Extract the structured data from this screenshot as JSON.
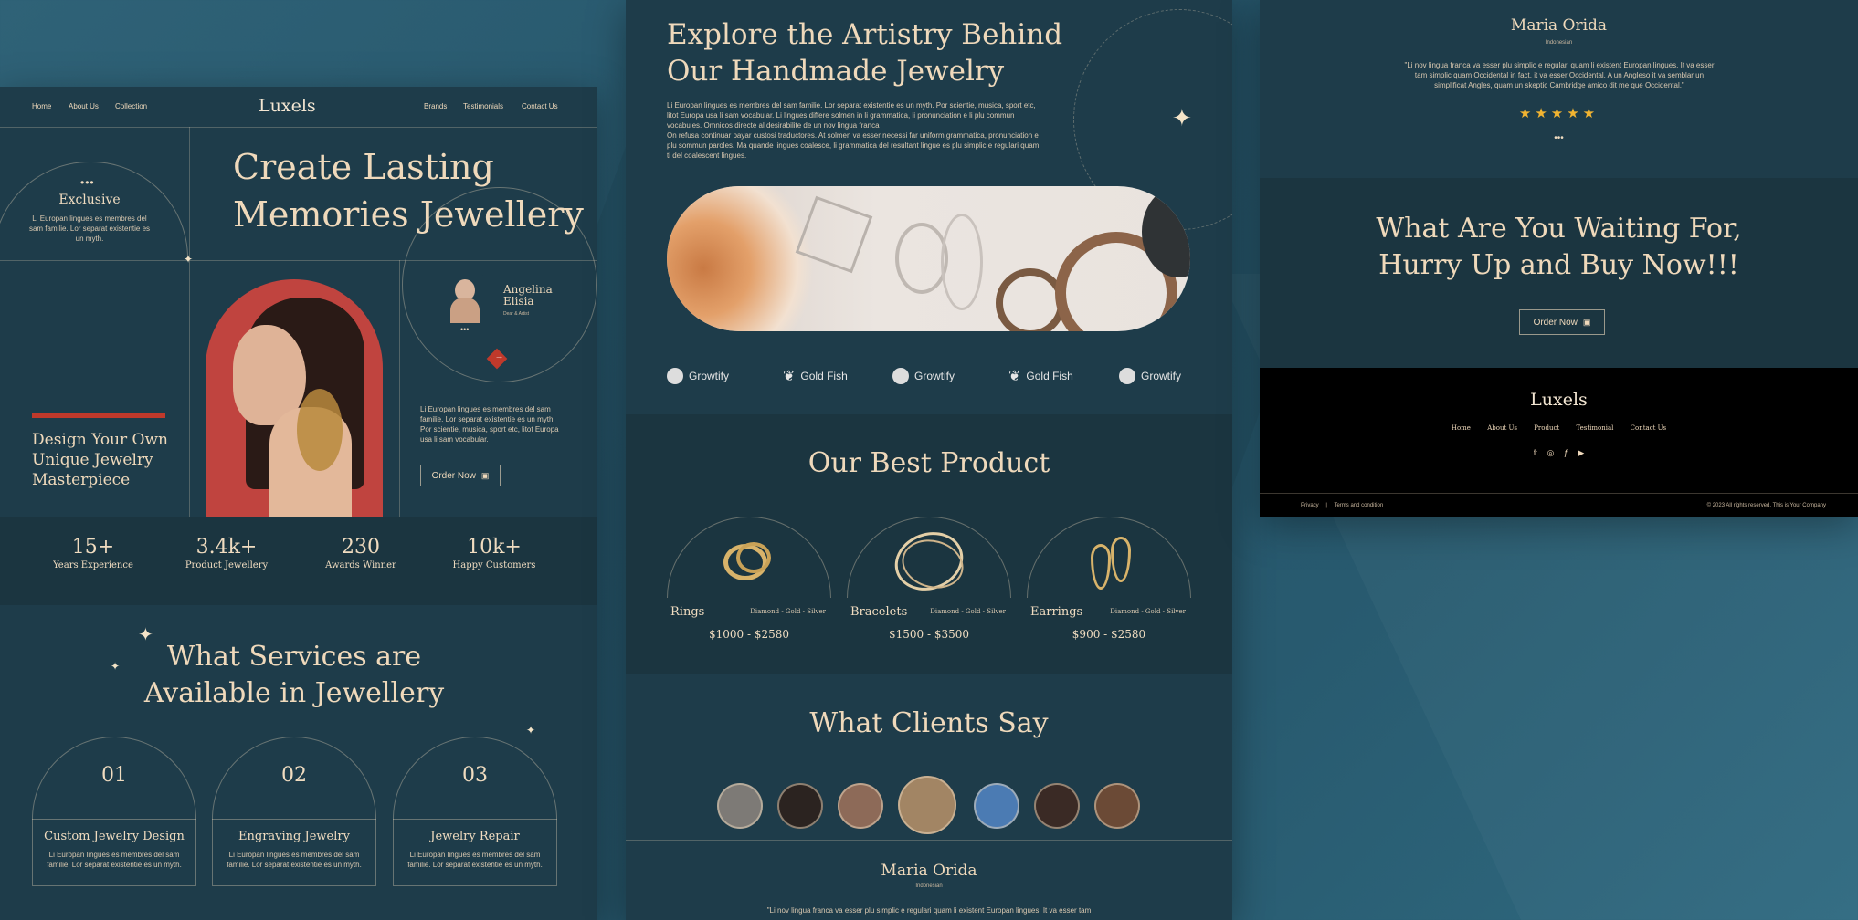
{
  "left": {
    "nav": {
      "home": "Home",
      "about": "About Us",
      "collection": "Collection",
      "brands": "Brands",
      "testimonials": "Testimonials",
      "contact": "Contact Us",
      "logo": "Luxels"
    },
    "exclusive": {
      "title": "Exclusive",
      "text": "Li Europan lingues es membres del sam familie. Lor separat existentie es un myth."
    },
    "hero_title_1": "Create Lasting",
    "hero_title_2": "Memories Jewellery",
    "side_title_1": "Design Your Own",
    "side_title_2": "Unique Jewelry",
    "side_title_3": "Masterpiece",
    "profile": {
      "name_1": "Angelina",
      "name_2": "Elisia",
      "role": "Dear & Artist"
    },
    "body_text": "Li Europan lingues es membres del sam familie. Lor separat existentie es un myth. Por scientie, musica, sport etc, litot Europa usa li sam vocabular.",
    "order_button": "Order Now",
    "stats": [
      {
        "value": "15+",
        "label": "Years Experience"
      },
      {
        "value": "3.4k+",
        "label": "Product Jewellery"
      },
      {
        "value": "230",
        "label": "Awards Winner"
      },
      {
        "value": "10k+",
        "label": "Happy Customers"
      }
    ],
    "services_title_1": "What Services are",
    "services_title_2": "Available in Jewellery",
    "services": [
      {
        "num": "01",
        "title": "Custom Jewelry Design",
        "text": "Li Europan lingues es membres del sam familie. Lor separat existentie es un myth."
      },
      {
        "num": "02",
        "title": "Engraving Jewelry",
        "text": "Li Europan lingues es membres del sam familie. Lor separat existentie es un myth."
      },
      {
        "num": "03",
        "title": "Jewelry Repair",
        "text": "Li Europan lingues es membres del sam familie. Lor separat existentie es un myth."
      }
    ]
  },
  "middle": {
    "title_1": "Explore the Artistry Behind",
    "title_2": "Our Handmade Jewelry",
    "para_1": "Li Europan lingues es membres del sam familie. Lor separat existentie es un myth. Por scientie, musica, sport etc, litot Europa usa li sam vocabular. Li lingues differe solmen in li grammatica, li pronunciation e li plu commun vocabules. Omnicos directe al desirabilite de un nov lingua franca",
    "para_2": "On refusa continuar payar custosi traductores. At solmen va esser necessi far uniform grammatica, pronunciation e plu sommun paroles. Ma quande lingues coalesce, li grammatica del resultant lingue es plu simplic e regulari quam ti del coalescent lingues.",
    "brands": [
      "Growtify",
      "Gold Fish",
      "Growtify",
      "Gold Fish",
      "Growtify"
    ],
    "products_title": "Our Best Product",
    "products": [
      {
        "name": "Rings",
        "materials": "Diamond - Gold - Silver",
        "price": "$1000 - $2580"
      },
      {
        "name": "Bracelets",
        "materials": "Diamond - Gold - Silver",
        "price": "$1500 - $3500"
      },
      {
        "name": "Earrings",
        "materials": "Diamond - Gold - Silver",
        "price": "$900 - $2580"
      }
    ],
    "clients_title": "What Clients Say",
    "client_name": "Maria Orida",
    "client_country": "Indonesian",
    "client_quote": "\"Li nov lingua franca va esser plu simplic e regulari quam li existent Europan lingues. It va esser tam"
  },
  "right": {
    "client_name": "Maria Orida",
    "client_country": "Indonesian",
    "client_quote": "\"Li nov lingua franca va esser plu simplic e regulari quam li existent Europan lingues. It va esser tam simplic quam Occidental in fact, it va esser Occidental. A un Angleso it va semblar un simplificat Angles, quam un skeptic Cambridge amico dit me que Occidental.\"",
    "rating": 5,
    "cta_1": "What Are You Waiting For,",
    "cta_2": "Hurry Up and Buy Now!!!",
    "cta_button": "Order Now",
    "footer": {
      "logo": "Luxels",
      "links": [
        "Home",
        "About Us",
        "Product",
        "Testimonial",
        "Contact Us"
      ],
      "privacy": "Privacy",
      "terms": "Terms and condition",
      "copyright": "© 2023 All rights reserved. This is Your Company"
    }
  },
  "colors": {
    "panel": "#1e3c4a",
    "accent": "#c0392b",
    "cream": "#efd9bb",
    "gold": "#d8b36a"
  }
}
